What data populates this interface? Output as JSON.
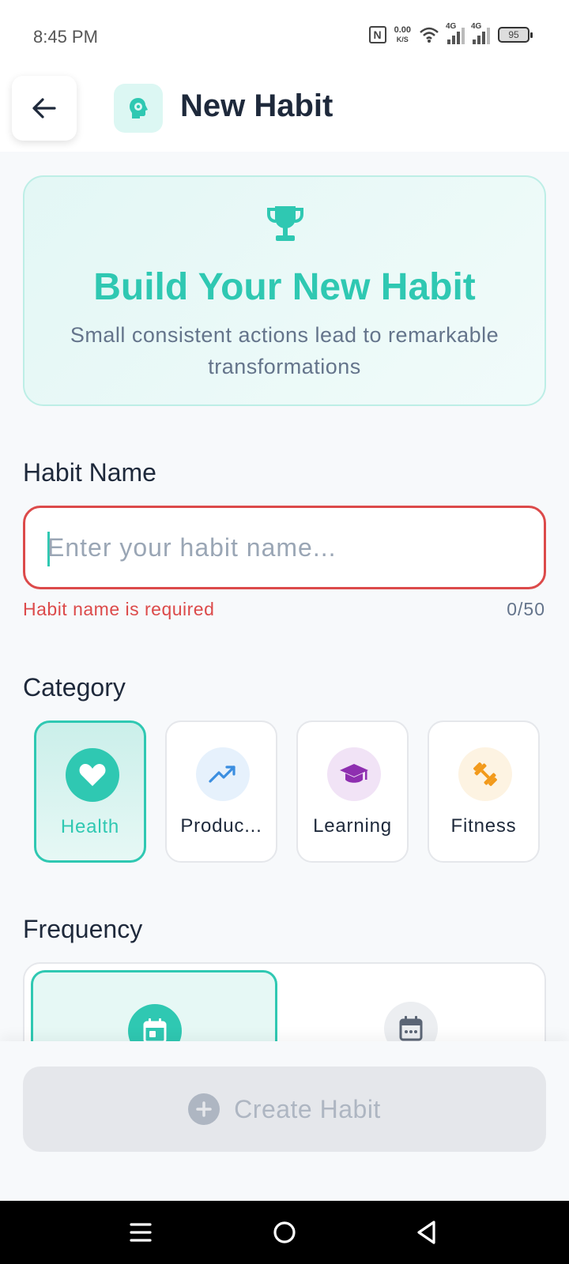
{
  "status_bar": {
    "time": "8:45 PM",
    "net_speed_value": "0.00",
    "net_speed_unit": "K/S",
    "signal_1_label": "4G",
    "signal_2_label": "4G",
    "battery_level": "95"
  },
  "header": {
    "title": "New Habit",
    "back_icon": "arrow-left-icon",
    "app_icon": "head-gear-icon"
  },
  "hero": {
    "title": "Build Your New Habit",
    "subtitle": "Small consistent actions lead to remarkable transformations",
    "icon": "trophy-icon"
  },
  "habit_name": {
    "label": "Habit Name",
    "value": "",
    "placeholder": "Enter your habit name...",
    "error": "Habit name is required",
    "counter": "0/50"
  },
  "category": {
    "label": "Category",
    "items": [
      {
        "label": "Health",
        "icon": "heart-icon",
        "selected": true
      },
      {
        "label": "Produc...",
        "icon": "trending-up-icon",
        "selected": false
      },
      {
        "label": "Learning",
        "icon": "graduation-cap-icon",
        "selected": false
      },
      {
        "label": "Fitness",
        "icon": "dumbbell-icon",
        "selected": false
      }
    ]
  },
  "frequency": {
    "label": "Frequency",
    "options": [
      {
        "icon": "calendar-day-icon",
        "selected": true
      },
      {
        "icon": "calendar-icon",
        "selected": false
      }
    ]
  },
  "footer": {
    "create_label": "Create Habit",
    "create_icon": "plus-circle-icon"
  },
  "colors": {
    "accent": "#2fc8b2",
    "error": "#dc4a4a",
    "disabled": "#aeb6c2"
  }
}
